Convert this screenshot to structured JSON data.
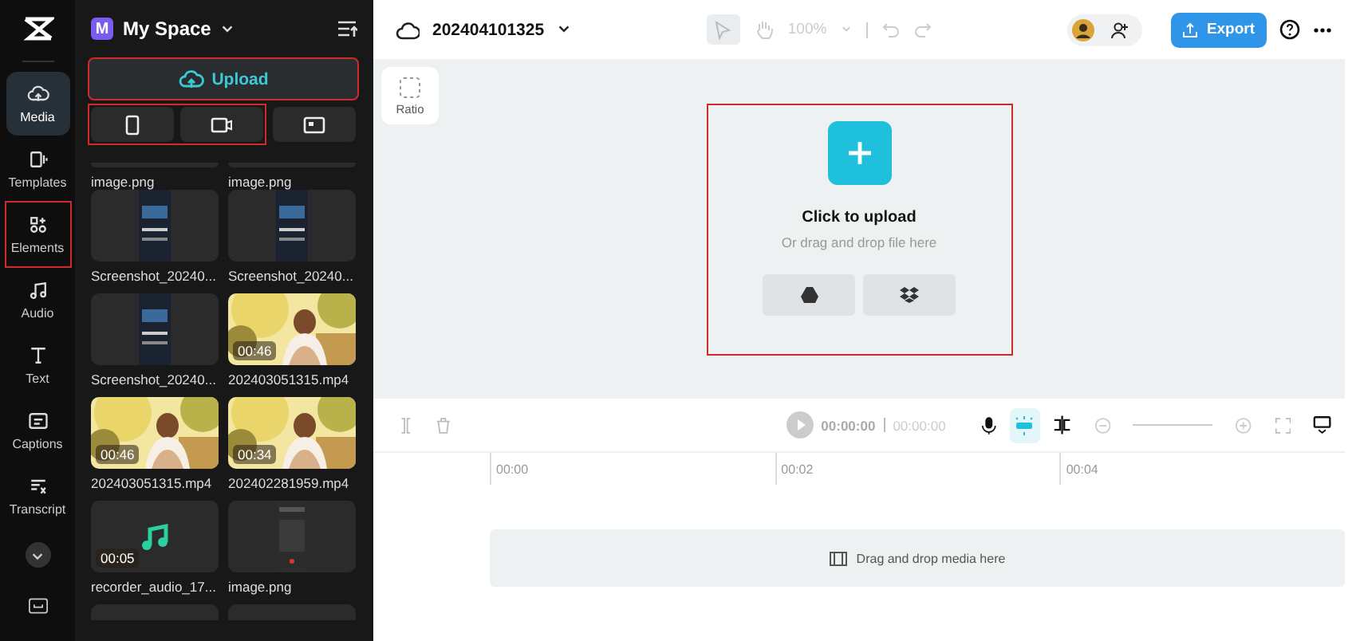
{
  "nav": {
    "items": [
      {
        "label": "Media",
        "selected": true,
        "highlighted": false
      },
      {
        "label": "Templates",
        "selected": false,
        "highlighted": false
      },
      {
        "label": "Elements",
        "selected": false,
        "highlighted": true
      },
      {
        "label": "Audio",
        "selected": false,
        "highlighted": false
      },
      {
        "label": "Text",
        "selected": false,
        "highlighted": false
      },
      {
        "label": "Captions",
        "selected": false,
        "highlighted": false
      },
      {
        "label": "Transcript",
        "selected": false,
        "highlighted": false
      }
    ]
  },
  "space": {
    "badge": "M",
    "title": "My Space"
  },
  "upload": {
    "label": "Upload",
    "highlighted": true
  },
  "sources": {
    "highlighted": true
  },
  "media_rows": [
    {
      "items": [
        {
          "kind": "tail",
          "name": "image.png"
        },
        {
          "kind": "tail",
          "name": "image.png"
        }
      ]
    },
    {
      "items": [
        {
          "kind": "screenshot",
          "name": "Screenshot_20240..."
        },
        {
          "kind": "screenshot",
          "name": "Screenshot_20240..."
        }
      ]
    },
    {
      "items": [
        {
          "kind": "screenshot",
          "name": "Screenshot_20240..."
        },
        {
          "kind": "video",
          "name": "202403051315.mp4",
          "duration": "00:46"
        }
      ]
    },
    {
      "items": [
        {
          "kind": "video",
          "name": "202403051315.mp4",
          "duration": "00:46"
        },
        {
          "kind": "video",
          "name": "202402281959.mp4",
          "duration": "00:34"
        }
      ]
    },
    {
      "items": [
        {
          "kind": "audio",
          "name": "recorder_audio_17...",
          "duration": "00:05"
        },
        {
          "kind": "phone",
          "name": "image.png"
        }
      ]
    },
    {
      "items": [
        {
          "kind": "peek"
        },
        {
          "kind": "peek"
        }
      ]
    }
  ],
  "project": {
    "title": "202404101325"
  },
  "zoom": "100%",
  "export": "Export",
  "ratio": "Ratio",
  "dropzone": {
    "title": "Click to upload",
    "subtitle": "Or drag and drop file here",
    "highlighted": true
  },
  "player": {
    "time": "00:00:00",
    "total": "00:00:00"
  },
  "ruler": [
    "00:00",
    "00:02",
    "00:04"
  ],
  "track": {
    "hint": "Drag and drop media here"
  }
}
